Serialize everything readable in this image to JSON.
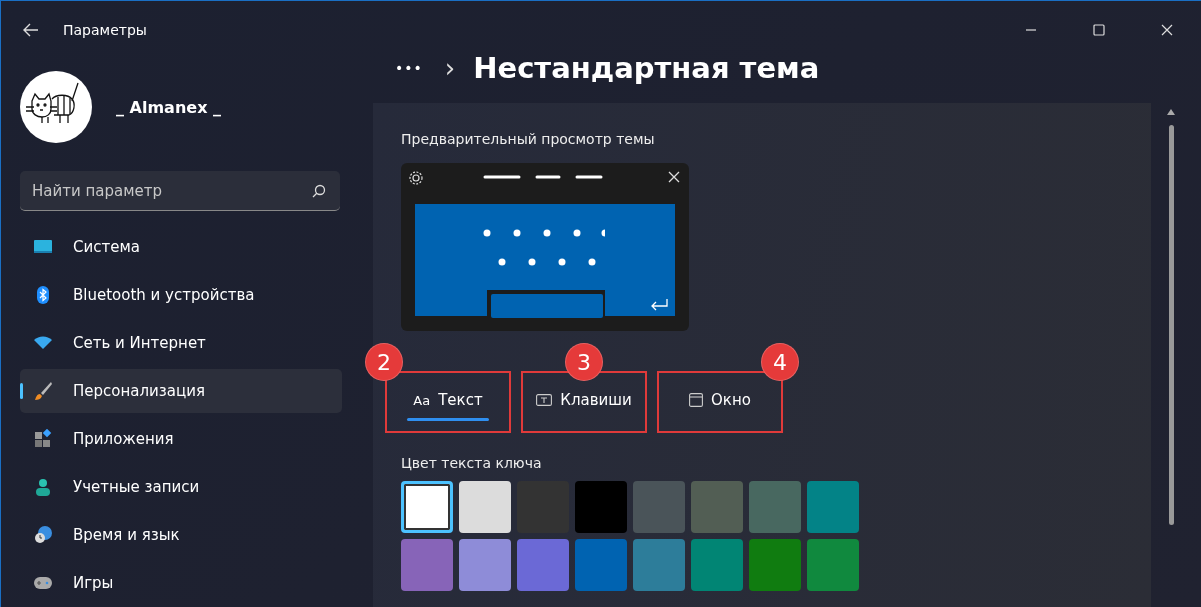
{
  "window": {
    "title": "Параметры"
  },
  "profile": {
    "name": "_ Almanex _"
  },
  "search": {
    "placeholder": "Найти параметр"
  },
  "sidebar": {
    "items": [
      {
        "label": "Система",
        "selected": false
      },
      {
        "label": "Bluetooth и устройства",
        "selected": false
      },
      {
        "label": "Сеть и Интернет",
        "selected": false
      },
      {
        "label": "Персонализация",
        "selected": true
      },
      {
        "label": "Приложения",
        "selected": false
      },
      {
        "label": "Учетные записи",
        "selected": false
      },
      {
        "label": "Время и язык",
        "selected": false
      },
      {
        "label": "Игры",
        "selected": false
      }
    ]
  },
  "breadcrumb": {
    "more": "•••",
    "separator": "›",
    "title": "Нестандартная тема"
  },
  "preview": {
    "label": "Предварительный просмотр темы"
  },
  "tabs": [
    {
      "kind": "text",
      "glyph": "Aa",
      "label": "Текст",
      "selected": true,
      "annotated": true,
      "badge": "2"
    },
    {
      "kind": "keys",
      "label": "Клавиши",
      "selected": false,
      "annotated": true,
      "badge": "3"
    },
    {
      "kind": "window",
      "label": "Окно",
      "selected": false,
      "annotated": true,
      "badge": "4"
    }
  ],
  "key_text_color": {
    "label": "Цвет текста ключа",
    "swatches": [
      {
        "color": "#ffffff",
        "selected": true
      },
      {
        "color": "#dcdcdc",
        "selected": false
      },
      {
        "color": "#333333",
        "selected": false
      },
      {
        "color": "#000000",
        "selected": false
      },
      {
        "color": "#4a5459",
        "selected": false
      },
      {
        "color": "#525e54",
        "selected": false
      },
      {
        "color": "#486860",
        "selected": false
      },
      {
        "color": "#038387",
        "selected": false
      },
      {
        "color": "#8764b8",
        "selected": false
      },
      {
        "color": "#8e8cd8",
        "selected": false
      },
      {
        "color": "#6b69d6",
        "selected": false
      },
      {
        "color": "#0063b1",
        "selected": false
      },
      {
        "color": "#2d7d9a",
        "selected": false
      },
      {
        "color": "#018574",
        "selected": false
      },
      {
        "color": "#107c10",
        "selected": false
      },
      {
        "color": "#10893e",
        "selected": false
      }
    ]
  }
}
